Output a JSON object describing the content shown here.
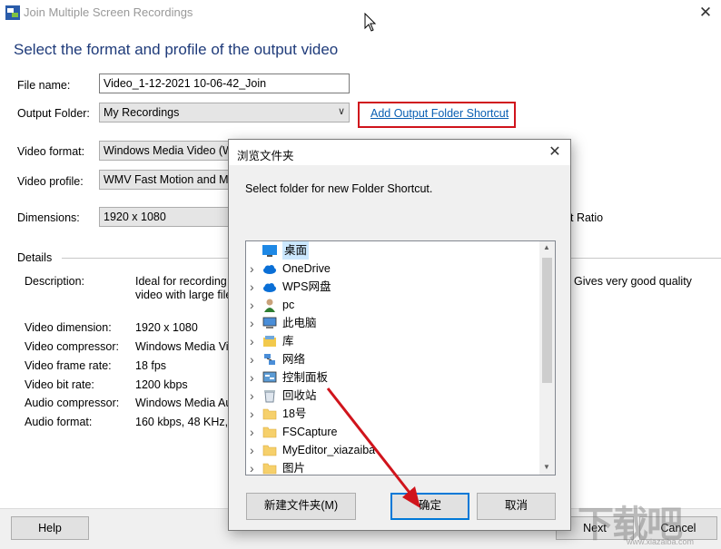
{
  "window": {
    "title": "Join Multiple Screen Recordings",
    "close_symbol": "✕"
  },
  "main": {
    "heading": "Select the format and profile of the output video",
    "file_name_label": "File name:",
    "file_name_value": "Video_1-12-2021 10-06-42_Join",
    "output_folder_label": "Output Folder:",
    "output_folder_value": "My Recordings",
    "add_shortcut_link": "Add Output Folder Shortcut",
    "video_format_label": "Video format:",
    "video_format_value": "Windows Media Video (W",
    "video_profile_label": "Video profile:",
    "video_profile_value": "WMV Fast Motion and Mu",
    "dimensions_label": "Dimensions:",
    "dimensions_value": "1920 x 1080",
    "aspect_ratio_fragment": "t Ratio",
    "details_label": "Details",
    "description_label": "Description:",
    "description_line1": "Ideal for recording",
    "description_line2": "video with large file",
    "description_right": "Gives very good quality",
    "video_dimension_label": "Video dimension:",
    "video_dimension_value": "1920 x 1080",
    "video_compressor_label": "Video compressor:",
    "video_compressor_value": "Windows Media Vi",
    "video_frame_rate_label": "Video frame rate:",
    "video_frame_rate_value": "18 fps",
    "video_bit_rate_label": "Video bit rate:",
    "video_bit_rate_value": "1200 kbps",
    "audio_compressor_label": "Audio compressor:",
    "audio_compressor_value": "Windows Media Au",
    "audio_format_label": "Audio format:",
    "audio_format_value": "160 kbps, 48 KHz,"
  },
  "footer": {
    "help": "Help",
    "next": "Next",
    "cancel": "Cancel"
  },
  "dialog": {
    "title": "浏览文件夹",
    "close_symbol": "✕",
    "message": "Select folder for new Folder Shortcut.",
    "tree": [
      {
        "label": "桌面",
        "icon": "desktop-icon",
        "selected": true
      },
      {
        "label": "OneDrive",
        "icon": "cloud-icon"
      },
      {
        "label": "WPS网盘",
        "icon": "cloud-icon"
      },
      {
        "label": "pc",
        "icon": "user-icon"
      },
      {
        "label": "此电脑",
        "icon": "computer-icon"
      },
      {
        "label": "库",
        "icon": "library-icon"
      },
      {
        "label": "网络",
        "icon": "network-icon"
      },
      {
        "label": "控制面板",
        "icon": "control-panel-icon"
      },
      {
        "label": "回收站",
        "icon": "recycle-bin-icon"
      },
      {
        "label": "18号",
        "icon": "folder-icon"
      },
      {
        "label": "FSCapture",
        "icon": "folder-icon"
      },
      {
        "label": "MyEditor_xiazaiba",
        "icon": "folder-icon"
      },
      {
        "label": "图片",
        "icon": "folder-icon"
      }
    ],
    "new_folder_button": "新建文件夹(M)",
    "ok_button": "确定",
    "cancel_button": "取消"
  },
  "colors": {
    "heading": "#1f3b7a",
    "link": "#0a5fb3",
    "highlight_box": "#d0141c",
    "arrow": "#d0141c",
    "selection": "#cce8ff",
    "primary_button_border": "#0078d7"
  },
  "watermark": {
    "text": "下载吧",
    "url": "www.xiazaiba.com"
  }
}
